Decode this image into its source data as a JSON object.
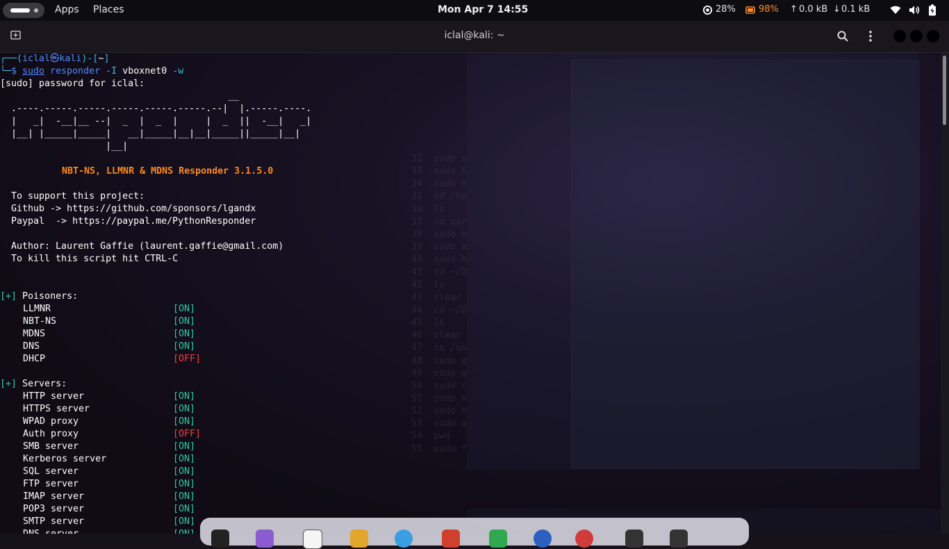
{
  "topbar": {
    "apps": "Apps",
    "places": "Places",
    "clock": "Mon Apr 7  14:55",
    "cpu": "28%",
    "battery": "98%",
    "upload": "0.0 kB",
    "download": "0.1 kB"
  },
  "terminal": {
    "title": "iclal@kali: ~",
    "prompt_user": "iclal",
    "prompt_host": "kali",
    "prompt_dir": "~",
    "command": {
      "sudo": "sudo",
      "cmd": "responder",
      "flag1": "-I",
      "arg1": "vboxnet0",
      "flag2": "-w"
    },
    "sudo_prompt": "[sudo] password for iclal:",
    "banner": [
      "                                         __",
      "  .----.-----.-----.-----.-----.-----.--|  |.-----.----.",
      "  |   _|  -__|__ --|  _  |  _  |     |  _  ||  -__|   _|",
      "  |__| |_____|_____|   __|_____|__|__|_____||_____|__|",
      "                   |__|"
    ],
    "responder_title": "NBT-NS, LLMNR & MDNS Responder 3.1.5.0",
    "support_heading": "  To support this project:",
    "github_line": "  Github -> https://github.com/sponsors/lgandx",
    "paypal_line": "  Paypal  -> https://paypal.me/PythonResponder",
    "author_line": "  Author: Laurent Gaffie (laurent.gaffie@gmail.com)",
    "kill_line": "  To kill this script hit CTRL-C",
    "plus": "[+]",
    "poisoners_heading": " Poisoners:",
    "poisoners": [
      {
        "name": "LLMNR",
        "status": "[ON]"
      },
      {
        "name": "NBT-NS",
        "status": "[ON]"
      },
      {
        "name": "MDNS",
        "status": "[ON]"
      },
      {
        "name": "DNS",
        "status": "[ON]"
      },
      {
        "name": "DHCP",
        "status": "[OFF]"
      }
    ],
    "servers_heading": " Servers:",
    "servers": [
      {
        "name": "HTTP server",
        "status": "[ON]"
      },
      {
        "name": "HTTPS server",
        "status": "[ON]"
      },
      {
        "name": "WPAD proxy",
        "status": "[ON]"
      },
      {
        "name": "Auth proxy",
        "status": "[OFF]"
      },
      {
        "name": "SMB server",
        "status": "[ON]"
      },
      {
        "name": "Kerberos server",
        "status": "[ON]"
      },
      {
        "name": "SQL server",
        "status": "[ON]"
      },
      {
        "name": "FTP server",
        "status": "[ON]"
      },
      {
        "name": "IMAP server",
        "status": "[ON]"
      },
      {
        "name": "POP3 server",
        "status": "[ON]"
      },
      {
        "name": "SMTP server",
        "status": "[ON]"
      },
      {
        "name": "DNS server",
        "status": "[ON]"
      }
    ]
  },
  "background_history": [
    "32  sudo s",
    "33  sudo h",
    "34  sudo h",
    "35  cd /ho",
    "36  ls",
    "37  cd usr",
    "38  sudo h",
    "39  sudo a",
    "40  sudo h",
    "41  cd ~/D",
    "42  ls",
    "43  clear",
    "44  cd ~/D",
    "45  ls",
    "46  clear",
    "47  ls /us",
    "48  sudo g",
    "49  sudo g",
    "50  sudo c",
    "51  sudo h",
    "52  sudo h",
    "53  sudo a",
    "54  pwd",
    "55  sudo f"
  ],
  "colors": {
    "prompt": "#3db7dc",
    "command": "#4f88ff",
    "title_orange": "#ff8a1c",
    "on": "#2fc9a5",
    "off": "#ff3b3b",
    "battery": "#ff8c2a"
  }
}
